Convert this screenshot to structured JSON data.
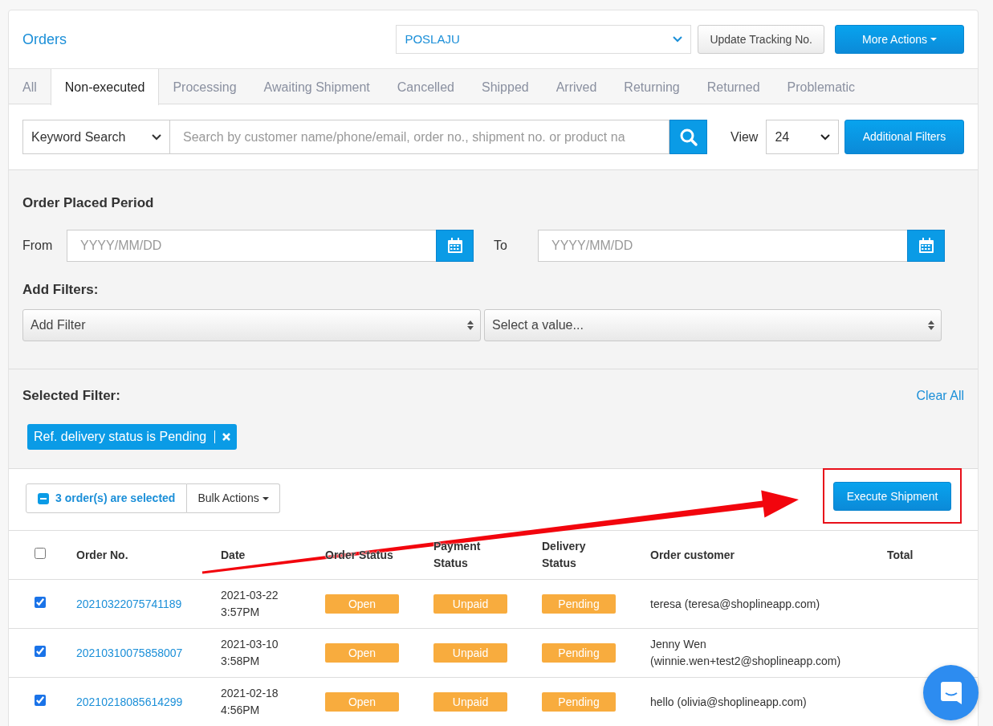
{
  "header": {
    "title": "Orders",
    "carrier": "POSLAJU",
    "update_button": "Update Tracking No.",
    "more_button": "More Actions"
  },
  "tabs": [
    {
      "label": "All",
      "selected": false
    },
    {
      "label": "Non-executed",
      "selected": true
    },
    {
      "label": "Processing",
      "selected": false
    },
    {
      "label": "Awaiting Shipment",
      "selected": false
    },
    {
      "label": "Cancelled",
      "selected": false
    },
    {
      "label": "Shipped",
      "selected": false
    },
    {
      "label": "Arrived",
      "selected": false
    },
    {
      "label": "Returning",
      "selected": false
    },
    {
      "label": "Returned",
      "selected": false
    },
    {
      "label": "Problematic",
      "selected": false
    }
  ],
  "search": {
    "mode": "Keyword Search",
    "placeholder": "Search by customer name/phone/email, order no., shipment no. or product na",
    "view_label": "View",
    "view_value": "24",
    "filters_button": "Additional Filters"
  },
  "period": {
    "title": "Order Placed Period",
    "from_label": "From",
    "from_placeholder": "YYYY/MM/DD",
    "to_label": "To",
    "to_placeholder": "YYYY/MM/DD"
  },
  "add_filters": {
    "title": "Add Filters:",
    "filter_select": "Add Filter",
    "value_select": "Select a value..."
  },
  "selected_filter": {
    "title": "Selected Filter:",
    "clear_all": "Clear All",
    "chips": [
      {
        "label": "Ref. delivery status is Pending"
      }
    ]
  },
  "bulk": {
    "selected_text": "3 order(s) are selected",
    "bulk_button": "Bulk Actions",
    "execute_button": "Execute Shipment"
  },
  "table": {
    "all_checked": false,
    "columns": [
      "Order No.",
      "Date",
      "Order Status",
      "Payment Status",
      "Delivery Status",
      "Order customer",
      "Total"
    ],
    "rows": [
      {
        "checked": true,
        "order_no": "20210322075741189",
        "date": "2021-03-22",
        "time": "3:57PM",
        "order_status": "Open",
        "payment_status": "Unpaid",
        "delivery_status": "Pending",
        "customer": "teresa (teresa@shoplineapp.com)"
      },
      {
        "checked": true,
        "order_no": "20210310075858007",
        "date": "2021-03-10",
        "time": "3:58PM",
        "order_status": "Open",
        "payment_status": "Unpaid",
        "delivery_status": "Pending",
        "customer": "Jenny Wen (winnie.wen+test2@shoplineapp.com)"
      },
      {
        "checked": true,
        "order_no": "20210218085614299",
        "date": "2021-02-18",
        "time": "4:56PM",
        "order_status": "Open",
        "payment_status": "Unpaid",
        "delivery_status": "Pending",
        "customer": "hello (olivia@shoplineapp.com)"
      }
    ]
  }
}
